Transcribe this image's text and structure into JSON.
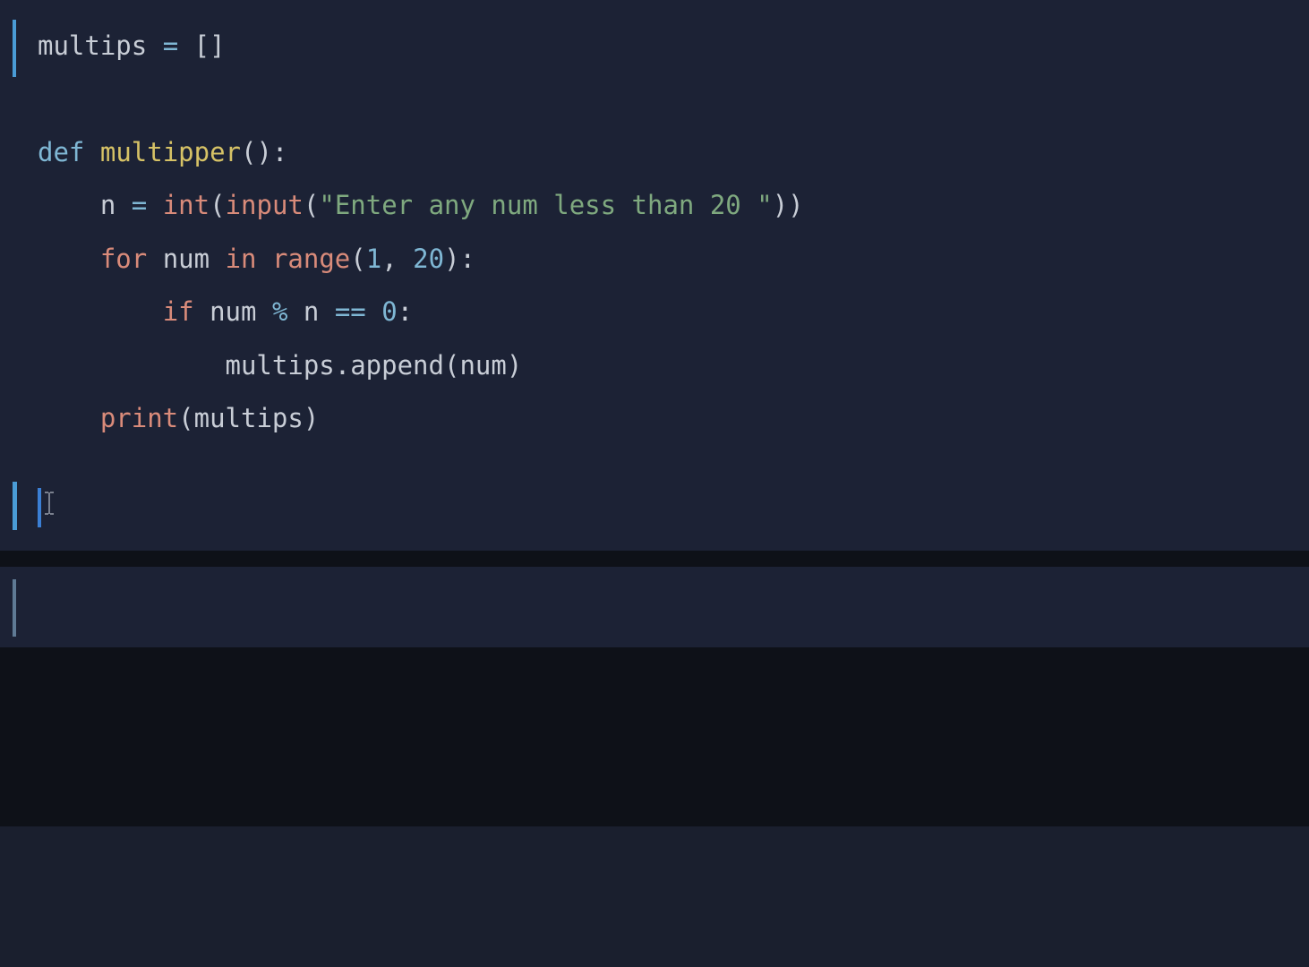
{
  "code": {
    "cell1": {
      "line1": {
        "var1": "multips",
        "op": "=",
        "brackets": "[]"
      },
      "line3": {
        "def": "def",
        "name": "multipper",
        "parens": "():"
      },
      "line4": {
        "var": "n",
        "op": "=",
        "int": "int",
        "input": "input",
        "string": "\"Enter any num less than 20 \""
      },
      "line5": {
        "for": "for",
        "var": "num",
        "in": "in",
        "range": "range",
        "n1": "1",
        "n2": "20"
      },
      "line6": {
        "if": "if",
        "var1": "num",
        "mod": "%",
        "var2": "n",
        "eq": "==",
        "zero": "0"
      },
      "line7": {
        "var": "multips",
        "method": "append",
        "arg": "num"
      },
      "line8": {
        "print": "print",
        "arg": "multips"
      }
    }
  }
}
